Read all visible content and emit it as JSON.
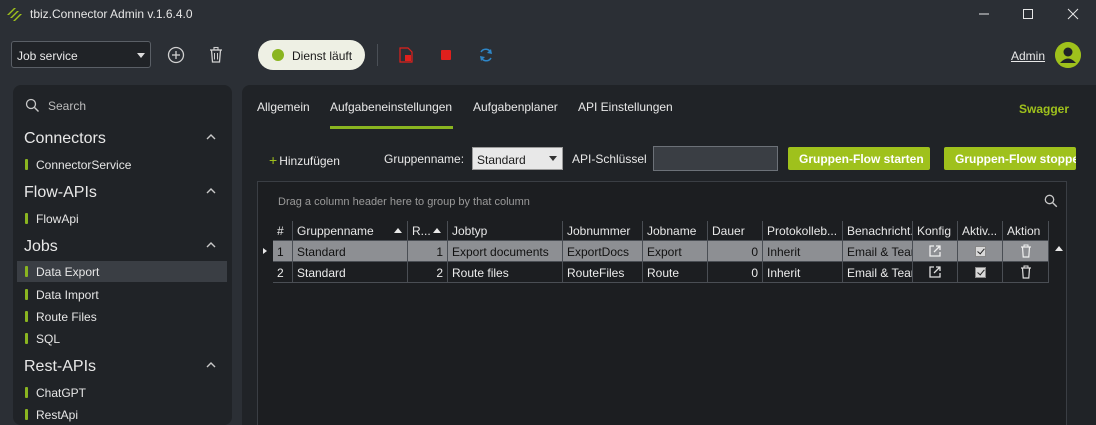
{
  "window": {
    "title": "tbiz.Connector Admin v.1.6.4.0",
    "controls": [
      "minimize-icon",
      "maximize-icon",
      "close-icon"
    ]
  },
  "toolbar": {
    "service_select": "Job service",
    "status": "Dienst läuft",
    "user": "Admin"
  },
  "colors": {
    "accent": "#9fc11c",
    "status_dot": "#8ab520",
    "stop_red": "#e0201c",
    "refresh_blue": "#2e86c7"
  },
  "sidebar": {
    "search_label": "Search",
    "sections": [
      {
        "title": "Connectors",
        "items": [
          "ConnectorService"
        ]
      },
      {
        "title": "Flow-APIs",
        "items": [
          "FlowApi"
        ]
      },
      {
        "title": "Jobs",
        "items": [
          "Data Export",
          "Data Import",
          "Route Files",
          "SQL"
        ],
        "active": "Data Export"
      },
      {
        "title": "Rest-APIs",
        "items": [
          "ChatGPT",
          "RestApi"
        ]
      }
    ]
  },
  "main": {
    "tabs": [
      "Allgemein",
      "Aufgabeneinstellungen",
      "Aufgabenplaner",
      "API Einstellungen"
    ],
    "active_tab": "Aufgabeneinstellungen",
    "swagger": "Swagger",
    "add_label": "Hinzufügen",
    "group_label": "Gruppenname:",
    "group_value": "Standard",
    "api_key_label": "API-Schlüssel",
    "api_key_value": "",
    "start_button": "Gruppen-Flow starten",
    "stop_button": "Gruppen-Flow stoppen"
  },
  "grid": {
    "group_hint": "Drag a column header here to group by that column",
    "columns": [
      "#",
      "Gruppenname",
      "R...",
      "Jobtyp",
      "Jobnummer",
      "Jobname",
      "Dauer",
      "Protokolleb...",
      "Benachricht...",
      "Konfig",
      "Aktiv...",
      "Aktion"
    ],
    "rows": [
      {
        "no": "1",
        "group": "Standard",
        "r": "1",
        "type": "Export documents",
        "number": "ExportDocs",
        "name": "Export",
        "duration": "0",
        "protocol": "Inherit",
        "notify": "Email & Teams",
        "active": true,
        "selected": true
      },
      {
        "no": "2",
        "group": "Standard",
        "r": "2",
        "type": "Route files",
        "number": "RouteFiles",
        "name": "Route",
        "duration": "0",
        "protocol": "Inherit",
        "notify": "Email & Teams",
        "active": true,
        "selected": false
      }
    ]
  }
}
